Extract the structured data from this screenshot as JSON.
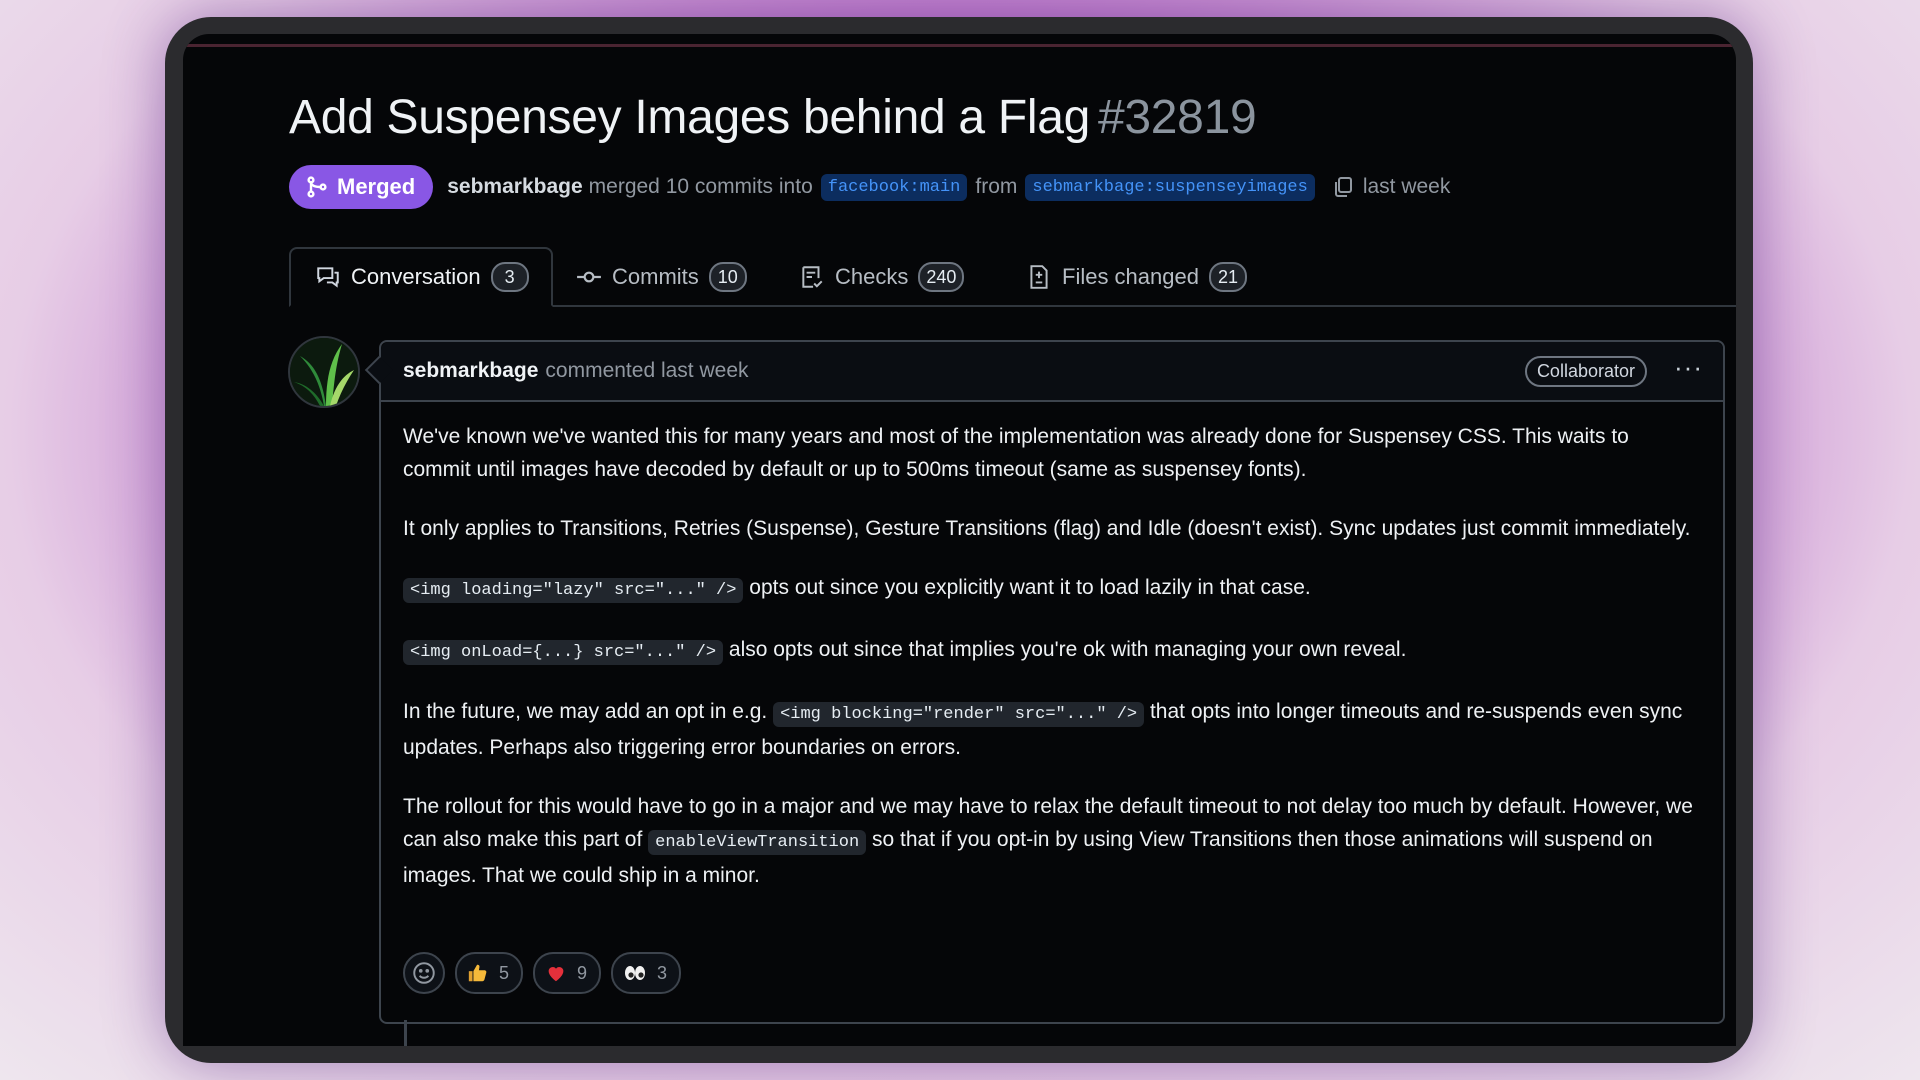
{
  "pr": {
    "title": "Add Suspensey Images behind a Flag",
    "number": "#32819",
    "status": "Merged",
    "author": "sebmarkbage",
    "merge_text": "merged 10 commits into",
    "base_branch": "facebook:main",
    "from_text": "from",
    "head_branch": "sebmarkbage:suspenseyimages",
    "time": "last week"
  },
  "tabs": [
    {
      "label": "Conversation",
      "count": "3"
    },
    {
      "label": "Commits",
      "count": "10"
    },
    {
      "label": "Checks",
      "count": "240"
    },
    {
      "label": "Files changed",
      "count": "21"
    }
  ],
  "comment": {
    "author": "sebmarkbage",
    "action": "commented last week",
    "role": "Collaborator",
    "more": "···",
    "p1": "We've known we've wanted this for many years and most of the implementation was already done for Suspensey CSS. This waits to commit until images have decoded by default or up to 500ms timeout (same as suspensey fonts).",
    "p2": "It only applies to Transitions, Retries (Suspense), Gesture Transitions (flag) and Idle (doesn't exist). Sync updates just commit immediately.",
    "p3_code": "<img loading=\"lazy\" src=\"...\" />",
    "p3_text": " opts out since you explicitly want it to load lazily in that case.",
    "p4_code": "<img onLoad={...} src=\"...\" />",
    "p4_text": " also opts out since that implies you're ok with managing your own reveal.",
    "p5_pre": "In the future, we may add an opt in e.g. ",
    "p5_code": "<img blocking=\"render\" src=\"...\" />",
    "p5_post": " that opts into longer timeouts and re-suspends even sync updates. Perhaps also triggering error boundaries on errors.",
    "p6_pre": "The rollout for this would have to go in a major and we may have to relax the default timeout to not delay too much by default. However, we can also make this part of ",
    "p6_code": "enableViewTransition",
    "p6_post": " so that if you opt-in by using View Transitions then those animations will suspend on images. That we could ship in a minor."
  },
  "reactions": [
    {
      "icon": "thumbs-up-icon",
      "count": "5"
    },
    {
      "icon": "heart-icon",
      "count": "9"
    },
    {
      "icon": "eyes-icon",
      "count": "3"
    }
  ],
  "colors": {
    "merged": "#8957e5",
    "link": "#4493f8",
    "background": "#050608"
  }
}
